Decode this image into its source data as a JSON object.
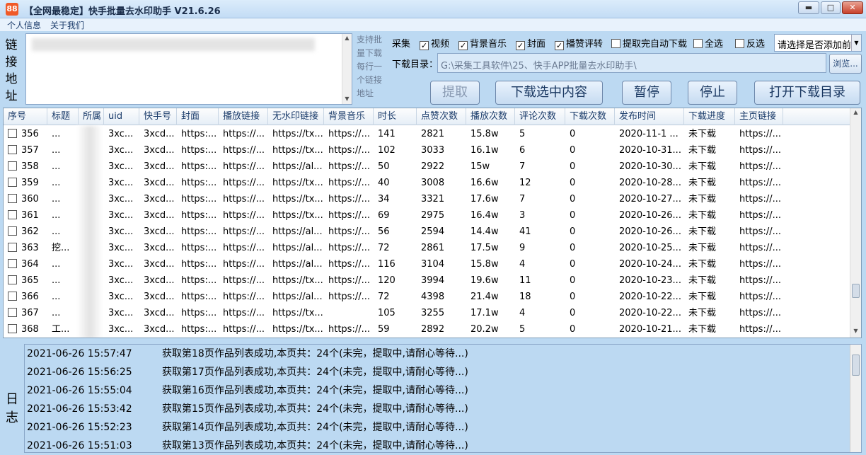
{
  "window": {
    "title": "【全网最稳定】快手批量去水印助手 V21.6.26",
    "icon_text": "88",
    "minimize": "▬",
    "maximize": "□",
    "close": "✕"
  },
  "menu": [
    "个人信息",
    "关于我们"
  ],
  "link_section": {
    "label": [
      "链",
      "接",
      "地",
      "址"
    ],
    "hint_lines": [
      "支持批",
      "量下载",
      "每行一",
      "个链接",
      "地址"
    ]
  },
  "collect": {
    "label": "采集",
    "options": [
      {
        "label": "视频",
        "checked": true
      },
      {
        "label": "背景音乐",
        "checked": true
      },
      {
        "label": "封面",
        "checked": true
      },
      {
        "label": "播赞评转",
        "checked": true
      },
      {
        "label": "提取完自动下载",
        "checked": false
      },
      {
        "label": "全选",
        "checked": false
      },
      {
        "label": "反选",
        "checked": false
      }
    ],
    "select_value": "请选择是否添加前"
  },
  "download_dir": {
    "label": "下载目录：",
    "path": "G:\\采集工具软件\\25、快手APP批量去水印助手\\",
    "browse": "浏览..."
  },
  "buttons": {
    "extract": "提取",
    "download_selected": "下载选中内容",
    "pause": "暂停",
    "stop": "停止",
    "open_dir": "打开下载目录"
  },
  "table": {
    "columns": [
      "序号",
      "标题",
      "所属",
      "uid",
      "快手号",
      "封面",
      "播放链接",
      "无水印链接",
      "背景音乐",
      "时长",
      "点赞次数",
      "播放次数",
      "评论次数",
      "下载次数",
      "发布时间",
      "下载进度",
      "主页链接"
    ],
    "rows": [
      [
        "356",
        "...",
        "",
        "3xc...",
        "3xcd...",
        "https:...",
        "https://...",
        "https://tx...",
        "https://...",
        "141",
        "2821",
        "15.8w",
        "5",
        "0",
        "2020-11-1 ...",
        "未下载",
        "https://..."
      ],
      [
        "357",
        "...",
        "",
        "3xc...",
        "3xcd...",
        "https:...",
        "https://...",
        "https://tx...",
        "https://...",
        "102",
        "3033",
        "16.1w",
        "6",
        "0",
        "2020-10-31...",
        "未下载",
        "https://..."
      ],
      [
        "358",
        "...",
        "",
        "3xc...",
        "3xcd...",
        "https:...",
        "https://...",
        "https://al...",
        "https://...",
        "50",
        "2922",
        "15w",
        "7",
        "0",
        "2020-10-30...",
        "未下载",
        "https://..."
      ],
      [
        "359",
        "...",
        "",
        "3xc...",
        "3xcd...",
        "https:...",
        "https://...",
        "https://tx...",
        "https://...",
        "40",
        "3008",
        "16.6w",
        "12",
        "0",
        "2020-10-28...",
        "未下载",
        "https://..."
      ],
      [
        "360",
        "...",
        "",
        "3xc...",
        "3xcd...",
        "https:...",
        "https://...",
        "https://tx...",
        "https://...",
        "34",
        "3321",
        "17.6w",
        "7",
        "0",
        "2020-10-27...",
        "未下载",
        "https://..."
      ],
      [
        "361",
        "...",
        "",
        "3xc...",
        "3xcd...",
        "https:...",
        "https://...",
        "https://tx...",
        "https://...",
        "69",
        "2975",
        "16.4w",
        "3",
        "0",
        "2020-10-26...",
        "未下载",
        "https://..."
      ],
      [
        "362",
        "...",
        "",
        "3xc...",
        "3xcd...",
        "https:...",
        "https://...",
        "https://al...",
        "https://...",
        "56",
        "2594",
        "14.4w",
        "41",
        "0",
        "2020-10-26...",
        "未下载",
        "https://..."
      ],
      [
        "363",
        "挖...",
        "",
        "3xc...",
        "3xcd...",
        "https:...",
        "https://...",
        "https://al...",
        "https://...",
        "72",
        "2861",
        "17.5w",
        "9",
        "0",
        "2020-10-25...",
        "未下载",
        "https://..."
      ],
      [
        "364",
        "...",
        "",
        "3xc...",
        "3xcd...",
        "https:...",
        "https://...",
        "https://al...",
        "https://...",
        "116",
        "3104",
        "15.8w",
        "4",
        "0",
        "2020-10-24...",
        "未下载",
        "https://..."
      ],
      [
        "365",
        "...",
        "",
        "3xc...",
        "3xcd...",
        "https:...",
        "https://...",
        "https://tx...",
        "https://...",
        "120",
        "3994",
        "19.6w",
        "11",
        "0",
        "2020-10-23...",
        "未下载",
        "https://..."
      ],
      [
        "366",
        "...",
        "",
        "3xc...",
        "3xcd...",
        "https:...",
        "https://...",
        "https://al...",
        "https://...",
        "72",
        "4398",
        "21.4w",
        "18",
        "0",
        "2020-10-22...",
        "未下载",
        "https://..."
      ],
      [
        "367",
        "...",
        "",
        "3xc...",
        "3xcd...",
        "https:...",
        "https://...",
        "https://tx...",
        "",
        "105",
        "3255",
        "17.1w",
        "4",
        "0",
        "2020-10-22...",
        "未下载",
        "https://..."
      ],
      [
        "368",
        "工...",
        "",
        "3xc...",
        "3xcd...",
        "https:...",
        "https://...",
        "https://tx...",
        "https://...",
        "59",
        "2892",
        "20.2w",
        "5",
        "0",
        "2020-10-21...",
        "未下载",
        "https://..."
      ]
    ]
  },
  "log": {
    "label": [
      "日",
      "志"
    ],
    "entries": [
      {
        "time": "2021-06-26 15:57:47",
        "msg": "获取第18页作品列表成功,本页共：24个(未完，提取中,请耐心等待...)"
      },
      {
        "time": "2021-06-26 15:56:25",
        "msg": "获取第17页作品列表成功,本页共：24个(未完，提取中,请耐心等待...)"
      },
      {
        "time": "2021-06-26 15:55:04",
        "msg": "获取第16页作品列表成功,本页共：24个(未完，提取中,请耐心等待...)"
      },
      {
        "time": "2021-06-26 15:53:42",
        "msg": "获取第15页作品列表成功,本页共：24个(未完，提取中,请耐心等待...)"
      },
      {
        "time": "2021-06-26 15:52:23",
        "msg": "获取第14页作品列表成功,本页共：24个(未完，提取中,请耐心等待...)"
      },
      {
        "time": "2021-06-26 15:51:03",
        "msg": "获取第13页作品列表成功,本页共：24个(未完，提取中,请耐心等待...)"
      }
    ]
  }
}
